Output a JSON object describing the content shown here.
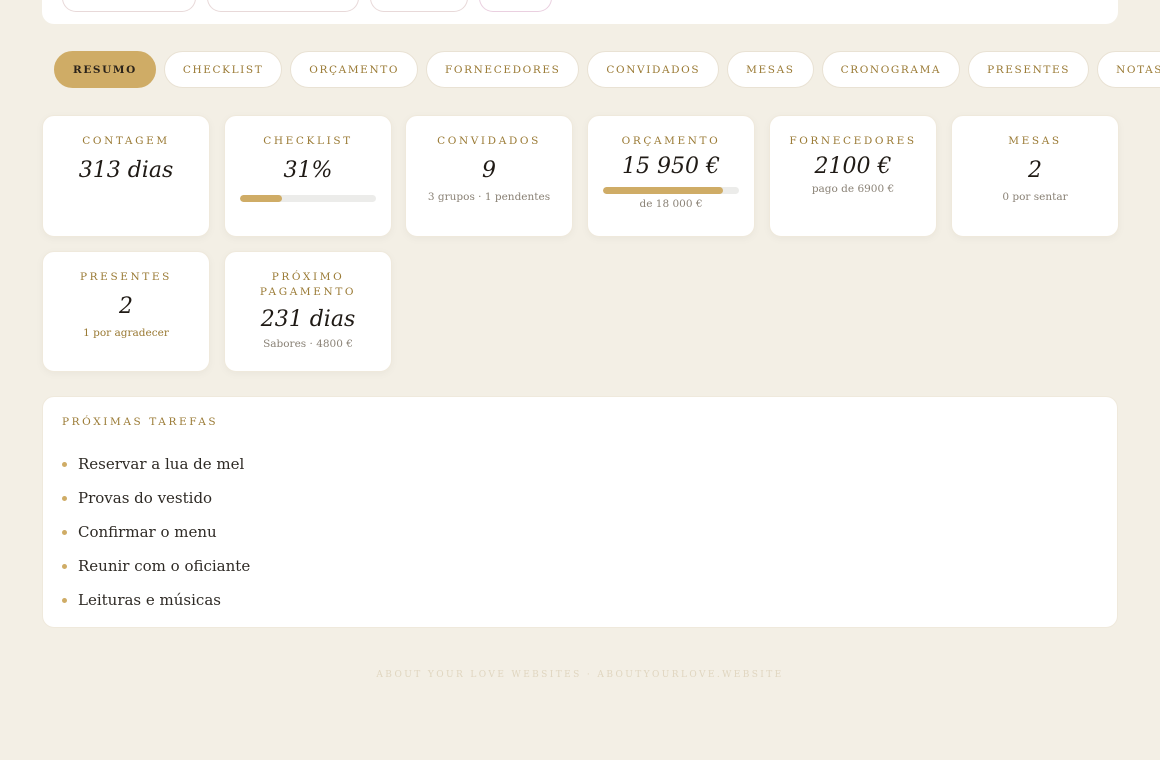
{
  "tabs": [
    "RESUMO",
    "CHECKLIST",
    "ORÇAMENTO",
    "FORNECEDORES",
    "CONVIDADOS",
    "MESAS",
    "CRONOGRAMA",
    "PRESENTES",
    "NOTAS"
  ],
  "active_tab": "RESUMO",
  "cards": {
    "contagem": {
      "label": "CONTAGEM",
      "value": "313 dias"
    },
    "checklist": {
      "label": "CHECKLIST",
      "value": "31%",
      "progress": 0.31
    },
    "convidados": {
      "label": "CONVIDADOS",
      "value": "9",
      "sub": "3 grupos · 1 pendentes"
    },
    "orcamento": {
      "label": "ORÇAMENTO",
      "value": "15 950 €",
      "sub": "de 18 000 €",
      "progress": 0.886
    },
    "fornecedores": {
      "label": "FORNECEDORES",
      "value": "2100 €",
      "sub": "pago de 6900 €"
    },
    "mesas": {
      "label": "MESAS",
      "value": "2",
      "sub": "0 por sentar"
    },
    "presentes": {
      "label": "PRESENTES",
      "value": "2",
      "sub": "1 por agradecer"
    },
    "proximo": {
      "label": "PRÓXIMO PAGAMENTO",
      "value": "231 dias",
      "sub": "Sabores · 4800 €"
    }
  },
  "tasks": {
    "title": "PRÓXIMAS TAREFAS",
    "items": [
      "Reservar a lua de mel",
      "Provas do vestido",
      "Confirmar o menu",
      "Reunir com o oficiante",
      "Leituras e músicas"
    ]
  },
  "footer": "ABOUT YOUR LOVE WEBSITES · ABOUTYOURLOVE.WEBSITE",
  "colors": {
    "accent": "#cfac66",
    "background": "#f3efe5",
    "label": "#9a7a34"
  }
}
